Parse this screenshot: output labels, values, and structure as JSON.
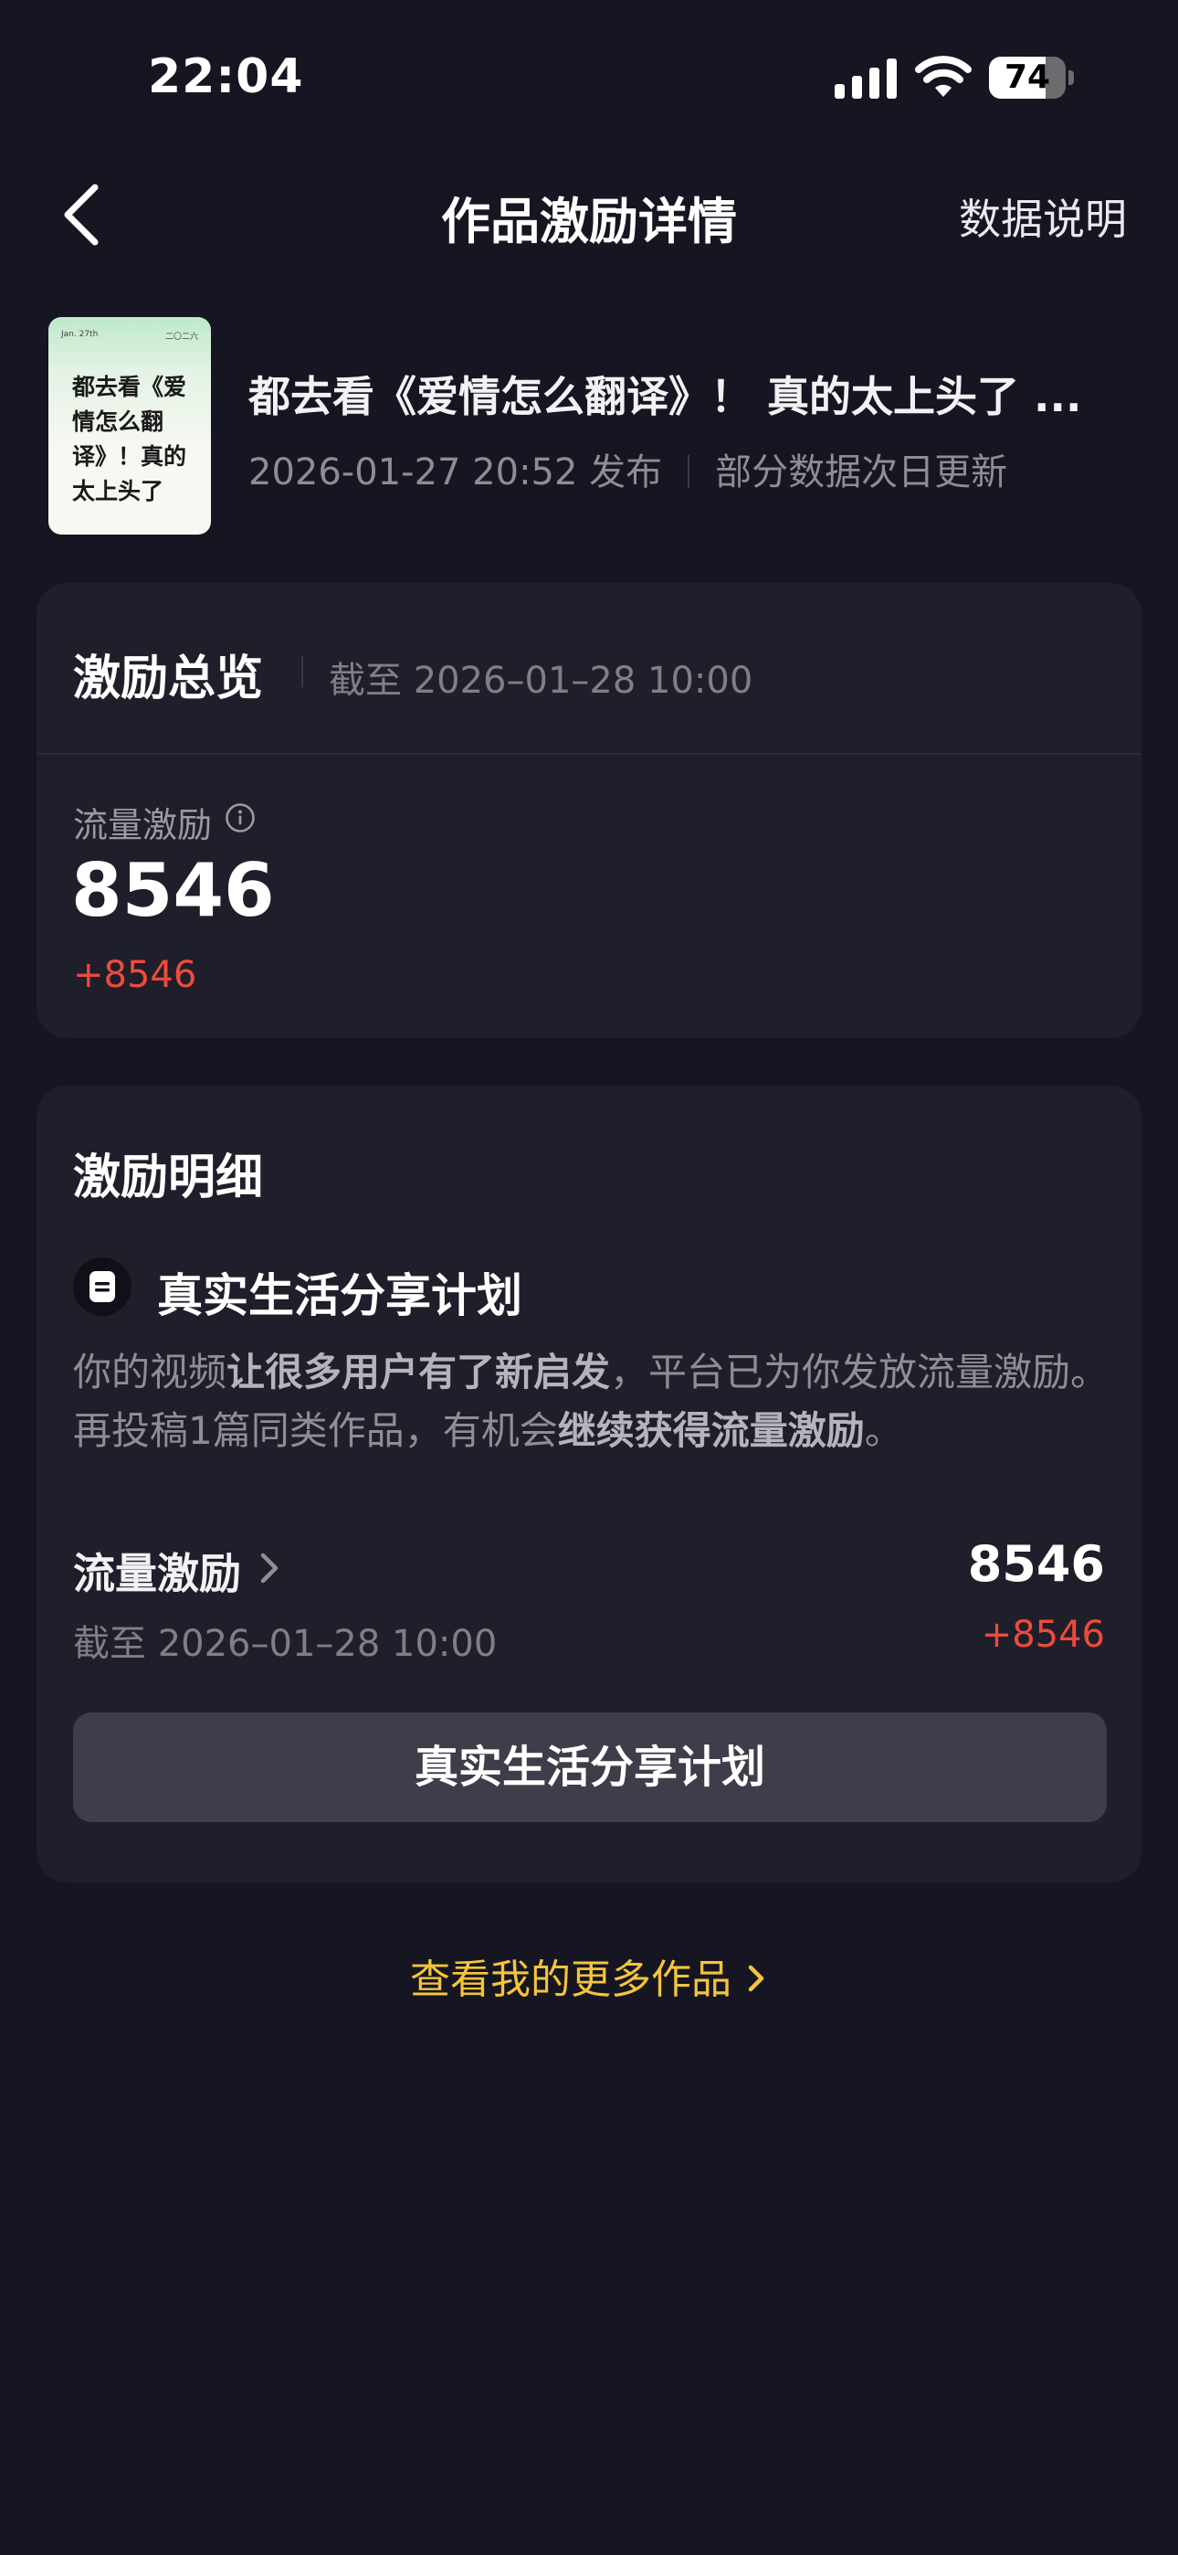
{
  "status_bar": {
    "time": "22:04",
    "battery_percent": "74",
    "battery_level": 0.74,
    "signal_icon": "cellular-signal-icon",
    "wifi_icon": "wifi-icon"
  },
  "nav": {
    "title": "作品激励详情",
    "action": "数据说明",
    "back_icon": "chevron-left-icon"
  },
  "video": {
    "thumbnail": {
      "date": "Jan. 27th",
      "corner_text": "二〇二六",
      "text": "都去看《爱情怎么翻译》！真的太上头了"
    },
    "title": "都去看《爱情怎么翻译》！ 真的太上头了 ...",
    "published": "2026-01-27 20:52 发布",
    "update_note": "部分数据次日更新"
  },
  "overview": {
    "title": "激励总览",
    "as_of": "截至 2026–01–28 10:00",
    "metric_label": "流量激励",
    "info_icon": "info-icon",
    "value": "8546",
    "delta": "+8546"
  },
  "detail": {
    "title": "激励明细",
    "plan_icon": "document-icon",
    "plan_name": "真实生活分享计划",
    "desc_1": "你的视频",
    "desc_2": "让很多用户有了新启发",
    "desc_3": "，平台已为你发放流量激励。再投稿1篇同类作品，有机会",
    "desc_4": "继续获得流量激励",
    "desc_5": "。",
    "flow_label": "流量激励",
    "flow_value": "8546",
    "flow_as_of": "截至 2026–01–28 10:00",
    "flow_delta": "+8546",
    "button_label": "真实生活分享计划"
  },
  "footer": {
    "more_link": "查看我的更多作品"
  },
  "colors": {
    "background": "#161622",
    "card": "#1f1f2b",
    "accent_red": "#f04a3a",
    "accent_yellow": "#f4c43c"
  }
}
